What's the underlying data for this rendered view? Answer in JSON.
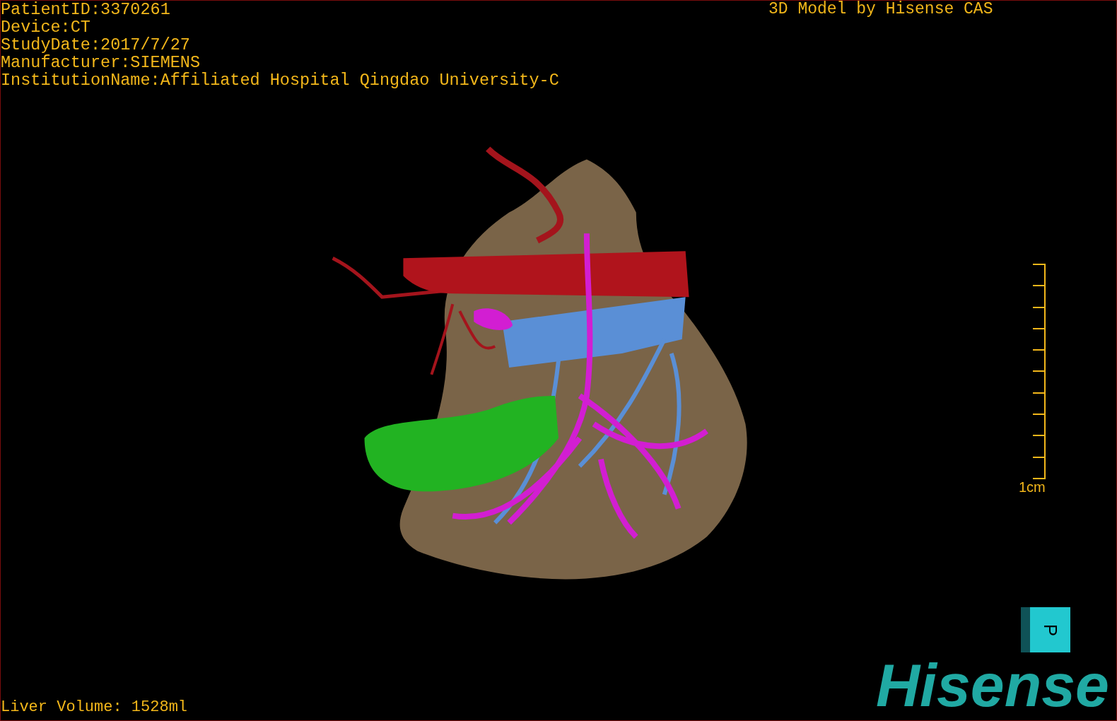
{
  "patient_info": [
    "PatientID:3370261",
    "Device:CT",
    "StudyDate:2017/7/27",
    "Manufacturer:SIEMENS",
    "InstitutionName:Affiliated Hospital Qingdao University-C"
  ],
  "title": "3D Model by Hisense CAS",
  "scale_bar": {
    "label": "1cm"
  },
  "orientation_cube": {
    "face": "P"
  },
  "liver_volume": "Liver Volume: 1528ml",
  "logo": "Hisense"
}
